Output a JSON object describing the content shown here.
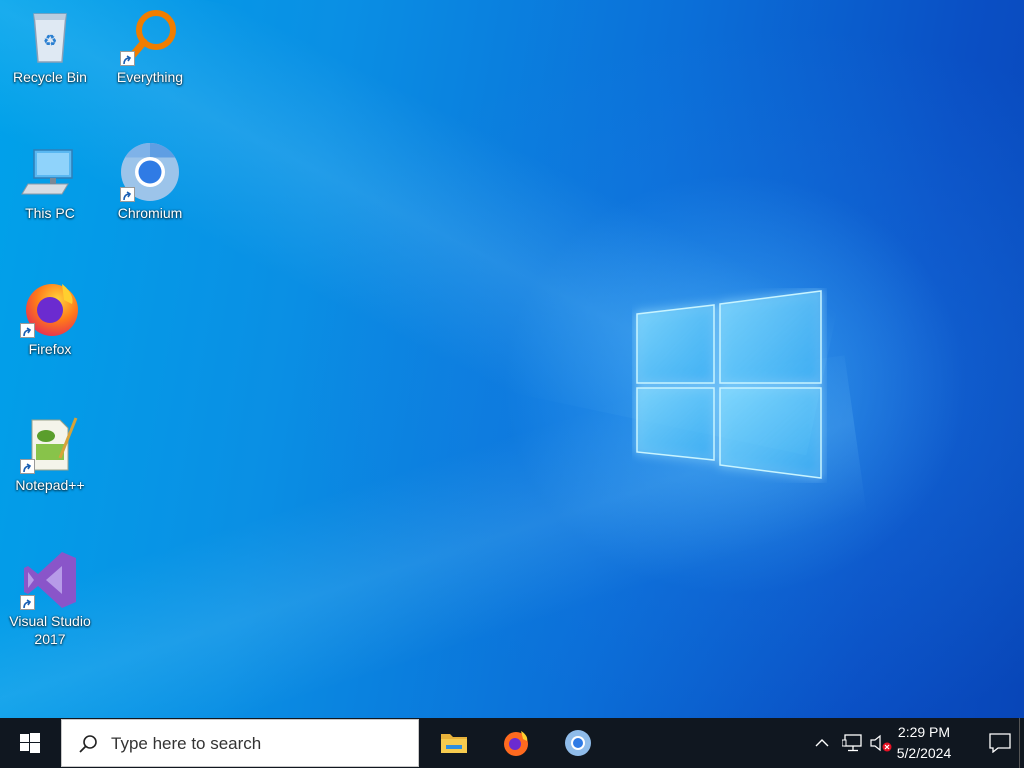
{
  "desktop": {
    "icons": [
      {
        "label": "Recycle Bin",
        "icon": "recycle-bin-icon",
        "shortcut": false
      },
      {
        "label": "Everything",
        "icon": "everything-search-icon",
        "shortcut": true
      },
      {
        "label": "This PC",
        "icon": "this-pc-icon",
        "shortcut": false
      },
      {
        "label": "Chromium",
        "icon": "chromium-icon",
        "shortcut": true
      },
      {
        "label": "Firefox",
        "icon": "firefox-icon",
        "shortcut": true
      },
      {
        "label": "Notepad++",
        "icon": "notepad-plus-plus-icon",
        "shortcut": true
      },
      {
        "label": "Visual Studio 2017",
        "icon": "visual-studio-icon",
        "shortcut": true
      }
    ],
    "wallpaper_colors": {
      "left": "#00a2ea",
      "right": "#0846b8",
      "glow": "#50beff"
    }
  },
  "taskbar": {
    "start": {
      "icon": "windows-start-icon"
    },
    "search": {
      "placeholder": "Type here to search",
      "icon": "search-icon"
    },
    "pinned": [
      {
        "name": "File Explorer",
        "icon": "file-explorer-icon"
      },
      {
        "name": "Firefox",
        "icon": "firefox-icon"
      },
      {
        "name": "Chromium",
        "icon": "chromium-icon"
      }
    ],
    "tray": {
      "icons": [
        "chevron-up-icon",
        "network-icon",
        "volume-muted-icon"
      ],
      "time": "2:29 PM",
      "date": "5/2/2024"
    },
    "action_center": {
      "icon": "notification-icon"
    },
    "background": "#101720"
  }
}
